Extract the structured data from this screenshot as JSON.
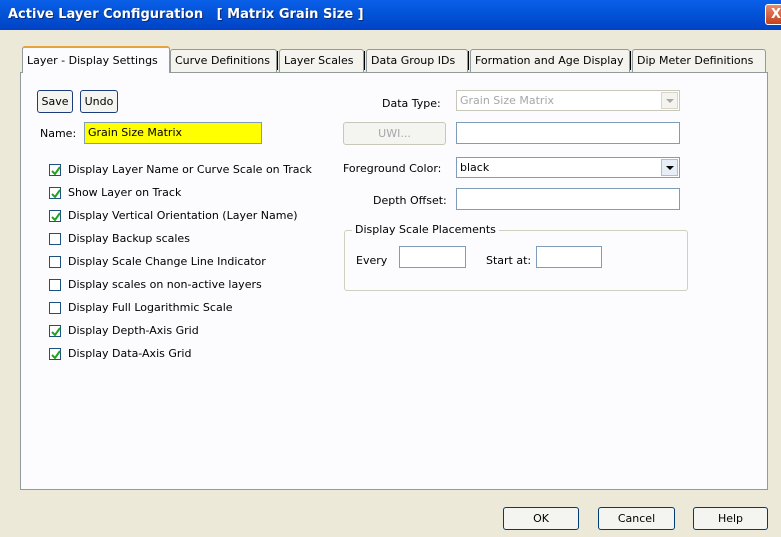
{
  "window": {
    "title": "Active Layer Configuration   [ Matrix Grain Size ]",
    "close_glyph": "X"
  },
  "tabs": [
    {
      "label": "Layer - Display Settings",
      "active": true
    },
    {
      "label": "Curve Definitions",
      "active": false
    },
    {
      "label": "Layer Scales",
      "active": false
    },
    {
      "label": "Data Group IDs",
      "active": false
    },
    {
      "label": "Formation and Age Display",
      "active": false
    },
    {
      "label": "Dip Meter Definitions",
      "active": false
    }
  ],
  "toolbar": {
    "save_label": "Save",
    "undo_label": "Undo"
  },
  "name_field": {
    "label": "Name:",
    "value": "Grain Size Matrix"
  },
  "checkboxes": [
    {
      "label": "Display Layer Name or Curve Scale on Track",
      "checked": true
    },
    {
      "label": "Show Layer on Track",
      "checked": true
    },
    {
      "label": "Display Vertical Orientation (Layer Name)",
      "checked": true
    },
    {
      "label": "Display Backup scales",
      "checked": false
    },
    {
      "label": "Display Scale Change Line Indicator",
      "checked": false
    },
    {
      "label": "Display scales on non-active layers",
      "checked": false
    },
    {
      "label": "Display Full Logarithmic Scale",
      "checked": false
    },
    {
      "label": "Display Depth-Axis Grid",
      "checked": true
    },
    {
      "label": "Display Data-Axis Grid",
      "checked": true
    }
  ],
  "data_type": {
    "label": "Data Type:",
    "value": "Grain Size Matrix",
    "disabled": true
  },
  "uwi": {
    "button_label": "UWI...",
    "value": ""
  },
  "foreground_color": {
    "label": "Foreground Color:",
    "value": "black"
  },
  "depth_offset": {
    "label": "Depth Offset:",
    "value": ""
  },
  "scale_placements": {
    "title": "Display Scale Placements",
    "every_label": "Every",
    "every_value": "",
    "start_label": "Start at:",
    "start_value": ""
  },
  "dialog_buttons": {
    "ok": "OK",
    "cancel": "Cancel",
    "help": "Help"
  },
  "colors": {
    "titlebar": "#0253d7",
    "name_field_bg": "#ffff00",
    "active_tab_accent": "#e6a23c",
    "dialog_bg": "#ece9d8"
  }
}
